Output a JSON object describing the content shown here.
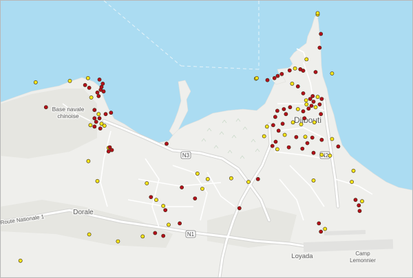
{
  "map": {
    "place_labels": {
      "base": "Base navale",
      "chinoise": "chinoise",
      "djibouti": "Djibouti",
      "dorale": "Dorale",
      "route": "Route Nationale 1",
      "loyada": "Loyada",
      "camp": "Camp",
      "lemonnier": "Lemonnier"
    },
    "shields": {
      "n3": "N3",
      "n2": "N2",
      "n1": "N1"
    },
    "colors": {
      "water": "#abdcf2",
      "land": "#efefec",
      "road": "#ffffff",
      "yellow_point": "#f5e41a",
      "red_point": "#b3101c"
    },
    "points": [
      {
        "lon": 0.77,
        "lat": 0.95,
        "c": "yellow"
      },
      {
        "lon": 0.778,
        "lat": 0.88,
        "c": "red"
      },
      {
        "lon": 0.775,
        "lat": 0.83,
        "c": "red"
      },
      {
        "lon": 0.743,
        "lat": 0.788,
        "c": "yellow"
      },
      {
        "lon": 0.765,
        "lat": 0.742,
        "c": "red"
      },
      {
        "lon": 0.715,
        "lat": 0.755,
        "c": "yellow"
      },
      {
        "lon": 0.702,
        "lat": 0.748,
        "c": "red"
      },
      {
        "lon": 0.728,
        "lat": 0.752,
        "c": "red"
      },
      {
        "lon": 0.735,
        "lat": 0.747,
        "c": "red"
      },
      {
        "lon": 0.683,
        "lat": 0.735,
        "c": "red"
      },
      {
        "lon": 0.673,
        "lat": 0.728,
        "c": "red"
      },
      {
        "lon": 0.665,
        "lat": 0.72,
        "c": "red"
      },
      {
        "lon": 0.805,
        "lat": 0.737,
        "c": "yellow"
      },
      {
        "lon": 0.62,
        "lat": 0.718,
        "c": "yellow"
      },
      {
        "lon": 0.648,
        "lat": 0.713,
        "c": "red"
      },
      {
        "lon": 0.708,
        "lat": 0.7,
        "c": "yellow"
      },
      {
        "lon": 0.722,
        "lat": 0.69,
        "c": "red"
      },
      {
        "lon": 0.735,
        "lat": 0.665,
        "c": "red"
      },
      {
        "lon": 0.758,
        "lat": 0.655,
        "c": "red"
      },
      {
        "lon": 0.742,
        "lat": 0.64,
        "c": "yellow"
      },
      {
        "lon": 0.752,
        "lat": 0.645,
        "c": "red"
      },
      {
        "lon": 0.76,
        "lat": 0.635,
        "c": "red"
      },
      {
        "lon": 0.77,
        "lat": 0.652,
        "c": "yellow"
      },
      {
        "lon": 0.78,
        "lat": 0.645,
        "c": "red"
      },
      {
        "lon": 0.743,
        "lat": 0.625,
        "c": "yellow"
      },
      {
        "lon": 0.755,
        "lat": 0.62,
        "c": "red"
      },
      {
        "lon": 0.765,
        "lat": 0.615,
        "c": "yellow"
      },
      {
        "lon": 0.775,
        "lat": 0.625,
        "c": "red"
      },
      {
        "lon": 0.748,
        "lat": 0.61,
        "c": "red"
      },
      {
        "lon": 0.735,
        "lat": 0.6,
        "c": "red"
      },
      {
        "lon": 0.722,
        "lat": 0.608,
        "c": "yellow"
      },
      {
        "lon": 0.703,
        "lat": 0.615,
        "c": "red"
      },
      {
        "lon": 0.688,
        "lat": 0.608,
        "c": "red"
      },
      {
        "lon": 0.672,
        "lat": 0.602,
        "c": "red"
      },
      {
        "lon": 0.693,
        "lat": 0.59,
        "c": "red"
      },
      {
        "lon": 0.738,
        "lat": 0.575,
        "c": "red"
      },
      {
        "lon": 0.762,
        "lat": 0.56,
        "c": "yellow"
      },
      {
        "lon": 0.778,
        "lat": 0.59,
        "c": "red"
      },
      {
        "lon": 0.667,
        "lat": 0.58,
        "c": "red"
      },
      {
        "lon": 0.685,
        "lat": 0.555,
        "c": "red"
      },
      {
        "lon": 0.71,
        "lat": 0.56,
        "c": "yellow"
      },
      {
        "lon": 0.73,
        "lat": 0.553,
        "c": "yellow"
      },
      {
        "lon": 0.647,
        "lat": 0.545,
        "c": "yellow"
      },
      {
        "lon": 0.662,
        "lat": 0.55,
        "c": "red"
      },
      {
        "lon": 0.675,
        "lat": 0.53,
        "c": "red"
      },
      {
        "lon": 0.69,
        "lat": 0.515,
        "c": "yellow"
      },
      {
        "lon": 0.718,
        "lat": 0.507,
        "c": "red"
      },
      {
        "lon": 0.74,
        "lat": 0.508,
        "c": "yellow"
      },
      {
        "lon": 0.757,
        "lat": 0.505,
        "c": "red"
      },
      {
        "lon": 0.745,
        "lat": 0.485,
        "c": "red"
      },
      {
        "lon": 0.78,
        "lat": 0.497,
        "c": "red"
      },
      {
        "lon": 0.64,
        "lat": 0.51,
        "c": "yellow"
      },
      {
        "lon": 0.668,
        "lat": 0.49,
        "c": "red"
      },
      {
        "lon": 0.66,
        "lat": 0.475,
        "c": "red"
      },
      {
        "lon": 0.672,
        "lat": 0.463,
        "c": "yellow"
      },
      {
        "lon": 0.7,
        "lat": 0.47,
        "c": "red"
      },
      {
        "lon": 0.733,
        "lat": 0.465,
        "c": "red"
      },
      {
        "lon": 0.76,
        "lat": 0.45,
        "c": "red"
      },
      {
        "lon": 0.78,
        "lat": 0.443,
        "c": "yellow"
      },
      {
        "lon": 0.8,
        "lat": 0.44,
        "c": "yellow"
      },
      {
        "lon": 0.805,
        "lat": 0.5,
        "c": "yellow"
      },
      {
        "lon": 0.82,
        "lat": 0.473,
        "c": "red"
      },
      {
        "lon": 0.857,
        "lat": 0.385,
        "c": "yellow"
      },
      {
        "lon": 0.853,
        "lat": 0.345,
        "c": "yellow"
      },
      {
        "lon": 0.862,
        "lat": 0.28,
        "c": "red"
      },
      {
        "lon": 0.87,
        "lat": 0.26,
        "c": "red"
      },
      {
        "lon": 0.872,
        "lat": 0.24,
        "c": "red"
      },
      {
        "lon": 0.773,
        "lat": 0.195,
        "c": "red"
      },
      {
        "lon": 0.778,
        "lat": 0.165,
        "c": "red"
      },
      {
        "lon": 0.788,
        "lat": 0.175,
        "c": "yellow"
      },
      {
        "lon": 0.76,
        "lat": 0.35,
        "c": "yellow"
      },
      {
        "lon": 0.625,
        "lat": 0.355,
        "c": "red"
      },
      {
        "lon": 0.602,
        "lat": 0.345,
        "c": "yellow"
      },
      {
        "lon": 0.56,
        "lat": 0.358,
        "c": "yellow"
      },
      {
        "lon": 0.49,
        "lat": 0.32,
        "c": "yellow"
      },
      {
        "lon": 0.472,
        "lat": 0.285,
        "c": "red"
      },
      {
        "lon": 0.44,
        "lat": 0.325,
        "c": "red"
      },
      {
        "lon": 0.365,
        "lat": 0.29,
        "c": "red"
      },
      {
        "lon": 0.378,
        "lat": 0.28,
        "c": "yellow"
      },
      {
        "lon": 0.395,
        "lat": 0.258,
        "c": "yellow"
      },
      {
        "lon": 0.4,
        "lat": 0.243,
        "c": "red"
      },
      {
        "lon": 0.435,
        "lat": 0.195,
        "c": "red"
      },
      {
        "lon": 0.408,
        "lat": 0.19,
        "c": "yellow"
      },
      {
        "lon": 0.375,
        "lat": 0.16,
        "c": "red"
      },
      {
        "lon": 0.395,
        "lat": 0.15,
        "c": "red"
      },
      {
        "lon": 0.345,
        "lat": 0.148,
        "c": "yellow"
      },
      {
        "lon": 0.58,
        "lat": 0.25,
        "c": "red"
      },
      {
        "lon": 0.503,
        "lat": 0.355,
        "c": "yellow"
      },
      {
        "lon": 0.478,
        "lat": 0.375,
        "c": "yellow"
      },
      {
        "lon": 0.355,
        "lat": 0.34,
        "c": "yellow"
      },
      {
        "lon": 0.27,
        "lat": 0.46,
        "c": "red"
      },
      {
        "lon": 0.262,
        "lat": 0.468,
        "c": "yellow"
      },
      {
        "lon": 0.235,
        "lat": 0.348,
        "c": "yellow"
      },
      {
        "lon": 0.213,
        "lat": 0.42,
        "c": "yellow"
      },
      {
        "lon": 0.403,
        "lat": 0.483,
        "c": "red"
      },
      {
        "lon": 0.285,
        "lat": 0.13,
        "c": "yellow"
      },
      {
        "lon": 0.215,
        "lat": 0.155,
        "c": "yellow"
      },
      {
        "lon": 0.048,
        "lat": 0.06,
        "c": "yellow"
      },
      {
        "lon": 0.11,
        "lat": 0.615,
        "c": "red"
      },
      {
        "lon": 0.085,
        "lat": 0.705,
        "c": "yellow"
      },
      {
        "lon": 0.168,
        "lat": 0.71,
        "c": "yellow"
      },
      {
        "lon": 0.205,
        "lat": 0.695,
        "c": "red"
      },
      {
        "lon": 0.212,
        "lat": 0.72,
        "c": "yellow"
      },
      {
        "lon": 0.215,
        "lat": 0.685,
        "c": "red"
      },
      {
        "lon": 0.22,
        "lat": 0.65,
        "c": "yellow"
      },
      {
        "lon": 0.228,
        "lat": 0.605,
        "c": "red"
      },
      {
        "lon": 0.238,
        "lat": 0.59,
        "c": "yellow"
      },
      {
        "lon": 0.232,
        "lat": 0.562,
        "c": "red"
      },
      {
        "lon": 0.245,
        "lat": 0.555,
        "c": "yellow"
      },
      {
        "lon": 0.255,
        "lat": 0.59,
        "c": "red"
      },
      {
        "lon": 0.268,
        "lat": 0.595,
        "c": "red"
      },
      {
        "lon": 0.228,
        "lat": 0.545,
        "c": "red"
      },
      {
        "lon": 0.242,
        "lat": 0.538,
        "c": "red"
      },
      {
        "lon": 0.252,
        "lat": 0.548,
        "c": "yellow"
      },
      {
        "lon": 0.238,
        "lat": 0.655,
        "c": "red"
      },
      {
        "lon": 0.243,
        "lat": 0.678,
        "c": "red"
      },
      {
        "lon": 0.248,
        "lat": 0.7,
        "c": "red"
      },
      {
        "lon": 0.24,
        "lat": 0.715,
        "c": "red"
      },
      {
        "lon": 0.245,
        "lat": 0.688,
        "c": "red"
      },
      {
        "lon": 0.25,
        "lat": 0.672,
        "c": "red"
      },
      {
        "lon": 0.235,
        "lat": 0.668,
        "c": "red"
      },
      {
        "lon": 0.218,
        "lat": 0.55,
        "c": "yellow"
      },
      {
        "lon": 0.228,
        "lat": 0.575,
        "c": "red"
      },
      {
        "lon": 0.24,
        "lat": 0.575,
        "c": "red"
      },
      {
        "lon": 0.265,
        "lat": 0.47,
        "c": "red"
      },
      {
        "lon": 0.262,
        "lat": 0.455,
        "c": "red"
      },
      {
        "lon": 0.622,
        "lat": 0.72,
        "c": "yellow"
      },
      {
        "lon": 0.77,
        "lat": 0.955,
        "c": "yellow"
      },
      {
        "lon": 0.878,
        "lat": 0.275,
        "c": "yellow"
      }
    ]
  }
}
